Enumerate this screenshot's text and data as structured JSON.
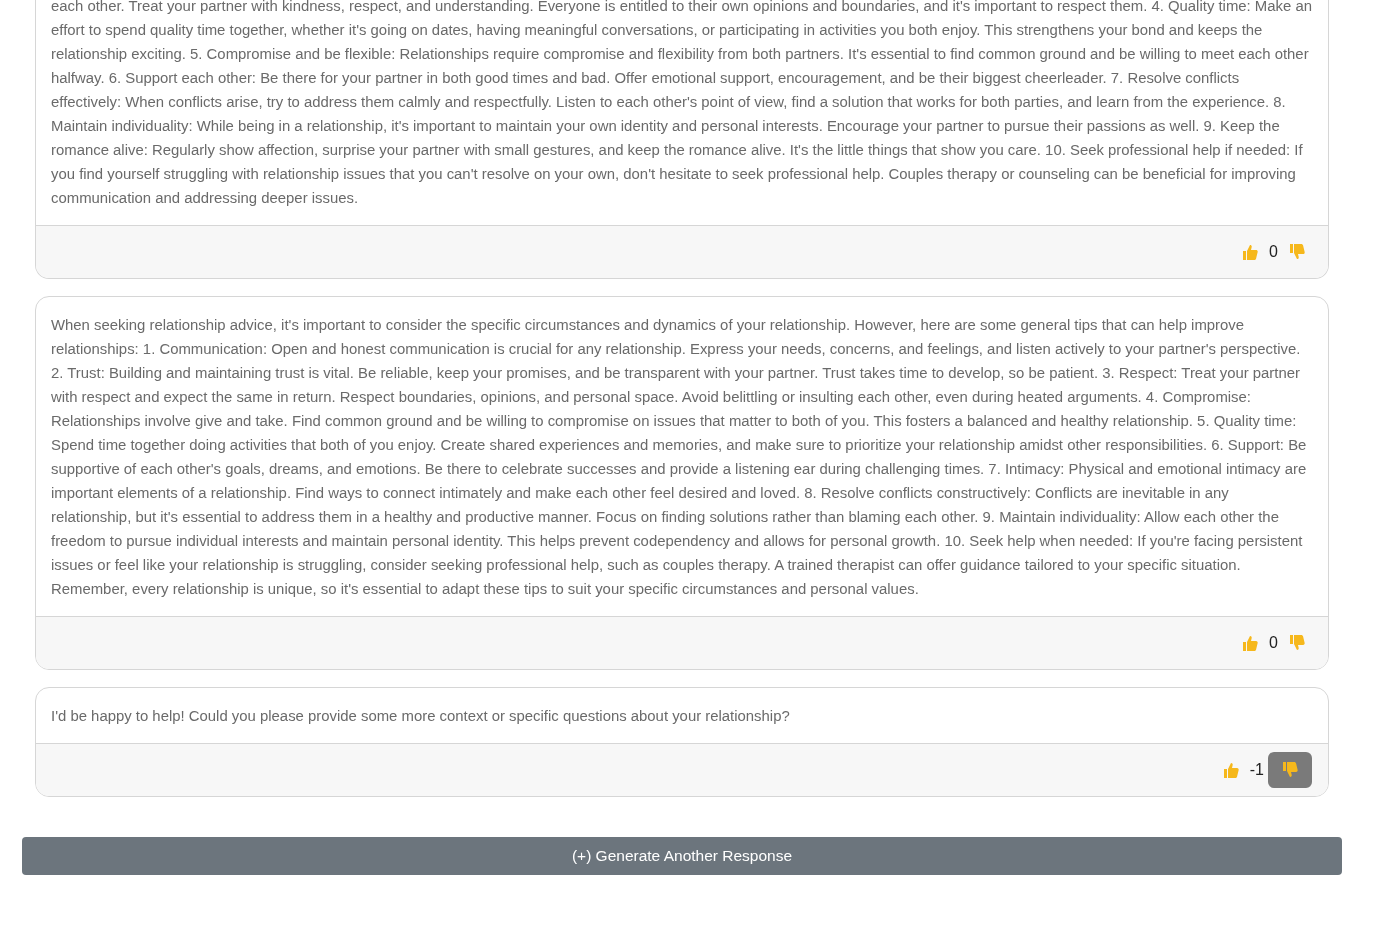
{
  "responses": [
    {
      "text": "each other. Treat your partner with kindness, respect, and understanding. Everyone is entitled to their own opinions and boundaries, and it's important to respect them. 4. Quality time: Make an effort to spend quality time together, whether it's going on dates, having meaningful conversations, or participating in activities you both enjoy. This strengthens your bond and keeps the relationship exciting. 5. Compromise and be flexible: Relationships require compromise and flexibility from both partners. It's essential to find common ground and be willing to meet each other halfway. 6. Support each other: Be there for your partner in both good times and bad. Offer emotional support, encouragement, and be their biggest cheerleader. 7. Resolve conflicts effectively: When conflicts arise, try to address them calmly and respectfully. Listen to each other's point of view, find a solution that works for both parties, and learn from the experience. 8. Maintain individuality: While being in a relationship, it's important to maintain your own identity and personal interests. Encourage your partner to pursue their passions as well. 9. Keep the romance alive: Regularly show affection, surprise your partner with small gestures, and keep the romance alive. It's the little things that show you care. 10. Seek professional help if needed: If you find yourself struggling with relationship issues that you can't resolve on your own, don't hesitate to seek professional help. Couples therapy or counseling can be beneficial for improving communication and addressing deeper issues.",
      "cut_top": true,
      "score": "0",
      "upvote_selected": false,
      "downvote_selected": false
    },
    {
      "text": "When seeking relationship advice, it's important to consider the specific circumstances and dynamics of your relationship. However, here are some general tips that can help improve relationships: 1. Communication: Open and honest communication is crucial for any relationship. Express your needs, concerns, and feelings, and listen actively to your partner's perspective. 2. Trust: Building and maintaining trust is vital. Be reliable, keep your promises, and be transparent with your partner. Trust takes time to develop, so be patient. 3. Respect: Treat your partner with respect and expect the same in return. Respect boundaries, opinions, and personal space. Avoid belittling or insulting each other, even during heated arguments. 4. Compromise: Relationships involve give and take. Find common ground and be willing to compromise on issues that matter to both of you. This fosters a balanced and healthy relationship. 5. Quality time: Spend time together doing activities that both of you enjoy. Create shared experiences and memories, and make sure to prioritize your relationship amidst other responsibilities. 6. Support: Be supportive of each other's goals, dreams, and emotions. Be there to celebrate successes and provide a listening ear during challenging times. 7. Intimacy: Physical and emotional intimacy are important elements of a relationship. Find ways to connect intimately and make each other feel desired and loved. 8. Resolve conflicts constructively: Conflicts are inevitable in any relationship, but it's essential to address them in a healthy and productive manner. Focus on finding solutions rather than blaming each other. 9. Maintain individuality: Allow each other the freedom to pursue individual interests and maintain personal identity. This helps prevent codependency and allows for personal growth. 10. Seek help when needed: If you're facing persistent issues or feel like your relationship is struggling, consider seeking professional help, such as couples therapy. A trained therapist can offer guidance tailored to your specific situation. Remember, every relationship is unique, so it's essential to adapt these tips to suit your specific circumstances and personal values.",
      "cut_top": false,
      "score": "0",
      "upvote_selected": false,
      "downvote_selected": false
    },
    {
      "text": "I'd be happy to help! Could you please provide some more context or specific questions about your relationship?",
      "cut_top": false,
      "score": "-1",
      "upvote_selected": false,
      "downvote_selected": true
    }
  ],
  "generate_button": "(+) Generate Another Response"
}
